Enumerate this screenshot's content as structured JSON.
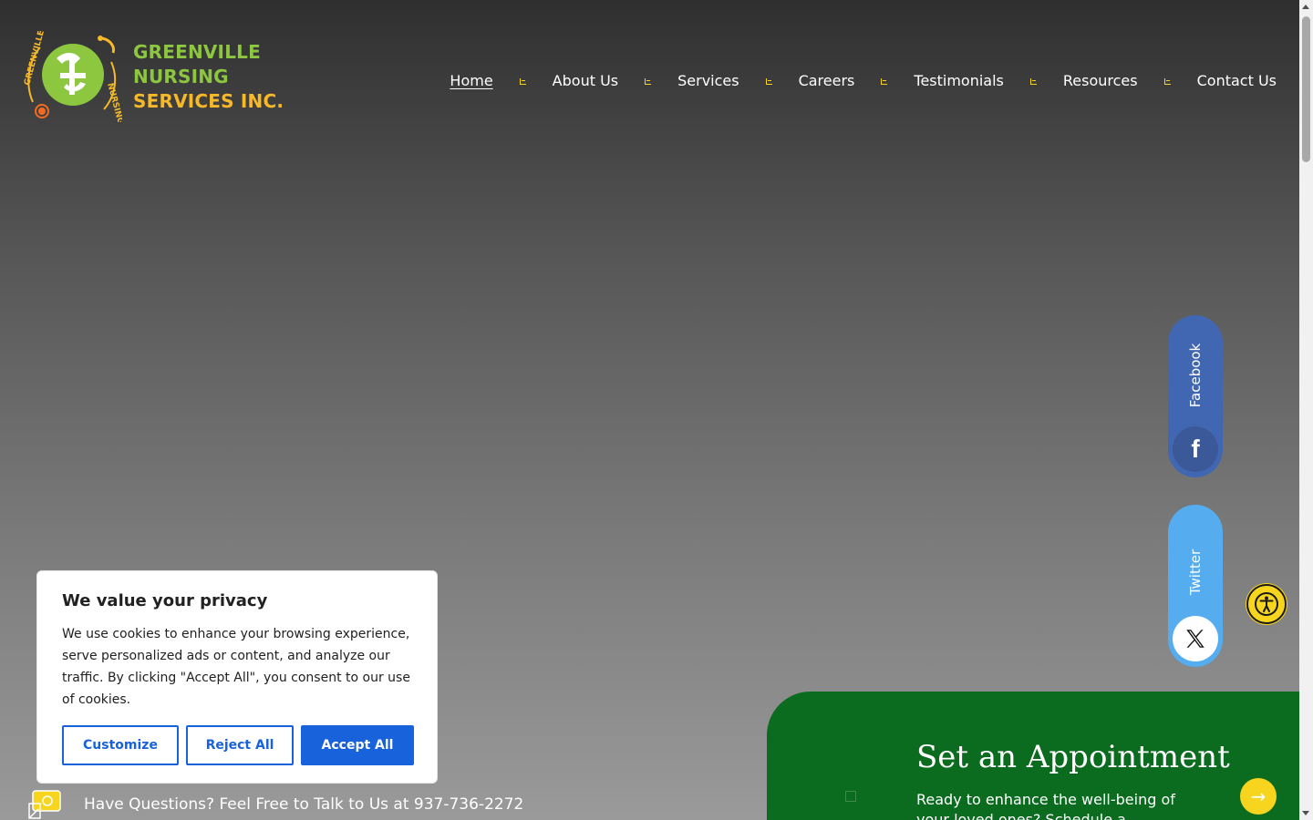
{
  "brand": {
    "name_line1": "GREENVILLE NURSING",
    "name_line2": "SERVICES INC.",
    "badge_top": "GREENVILLE",
    "badge_side": "NURSING",
    "colors": {
      "green": "#8dc63f",
      "gold": "#f7b928",
      "orange": "#f26b21"
    }
  },
  "nav": {
    "items": [
      {
        "label": "Home",
        "active": true
      },
      {
        "label": "About Us"
      },
      {
        "label": "Services"
      },
      {
        "label": "Careers"
      },
      {
        "label": "Testimonials"
      },
      {
        "label": "Resources"
      },
      {
        "label": "Contact Us"
      }
    ]
  },
  "social": {
    "facebook": {
      "label": "Facebook",
      "icon": "facebook-icon",
      "glyph": "f"
    },
    "twitter": {
      "label": "Twitter",
      "icon": "x-icon",
      "glyph": "𝕏"
    }
  },
  "accessibility": {
    "icon": "accessibility-icon"
  },
  "appointment": {
    "title": "Set an Appointment",
    "text": "Ready to enhance the well-being of your loved ones? Schedule a",
    "arrow": "→",
    "color": "#0b6b1f"
  },
  "question": {
    "text": "Have Questions? Feel Free to Talk to Us at 937-736-2272",
    "icon": "phone-chat-icon"
  },
  "cookie": {
    "title": "We value your privacy",
    "text": "We use cookies to enhance your browsing experience, serve personalized ads or content, and analyze our traffic. By clicking \"Accept All\", you consent to our use of cookies.",
    "customize": "Customize",
    "reject": "Reject All",
    "accept": "Accept All",
    "accent": "#1863dc"
  }
}
